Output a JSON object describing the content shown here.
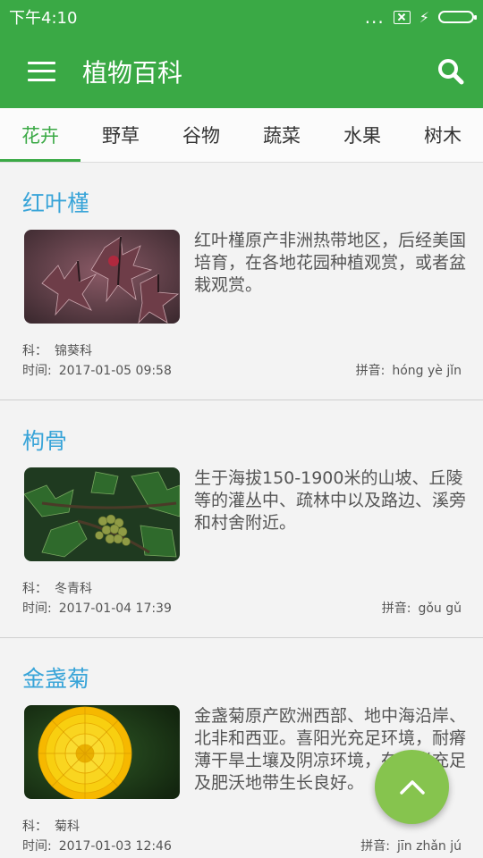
{
  "status_bar": {
    "time": "下午4:10",
    "dots": "..."
  },
  "app_bar": {
    "title": "植物百科"
  },
  "tabs": [
    "花卉",
    "野草",
    "谷物",
    "蔬菜",
    "水果",
    "树木"
  ],
  "active_tab": 0,
  "labels": {
    "family": "科：",
    "time": "时间:",
    "pinyin": "拼音:"
  },
  "plants": [
    {
      "name": "红叶槿",
      "description": "红叶槿原产非洲热带地区，后经美国培育，在各地花园种植观赏，或者盆栽观赏。",
      "family": "锦葵科",
      "time": "2017-01-05 09:58",
      "pinyin": "hóng yè jǐn"
    },
    {
      "name": "枸骨",
      "description": "生于海拔150-1900米的山坡、丘陵等的灌丛中、疏林中以及路边、溪旁和村舍附近。",
      "family": "冬青科",
      "time": "2017-01-04 17:39",
      "pinyin": "gǒu gǔ"
    },
    {
      "name": "金盏菊",
      "description": "金盏菊原产欧洲西部、地中海沿岸、北非和西亚。喜阳光充足环境，耐瘠薄干旱土壤及阴凉环境，在阳光充足及肥沃地带生长良好。",
      "family": "菊科",
      "time": "2017-01-03 12:46",
      "pinyin": "jīn zhǎn jú"
    }
  ],
  "colors": {
    "primary": "#3aa945",
    "title_blue": "#38a4d8",
    "fab": "#86c44e",
    "background": "#f3f3f3"
  },
  "icons": [
    "menu-icon",
    "search-icon",
    "chevron-up-icon",
    "battery-icon",
    "charging-icon",
    "sim-icon"
  ]
}
